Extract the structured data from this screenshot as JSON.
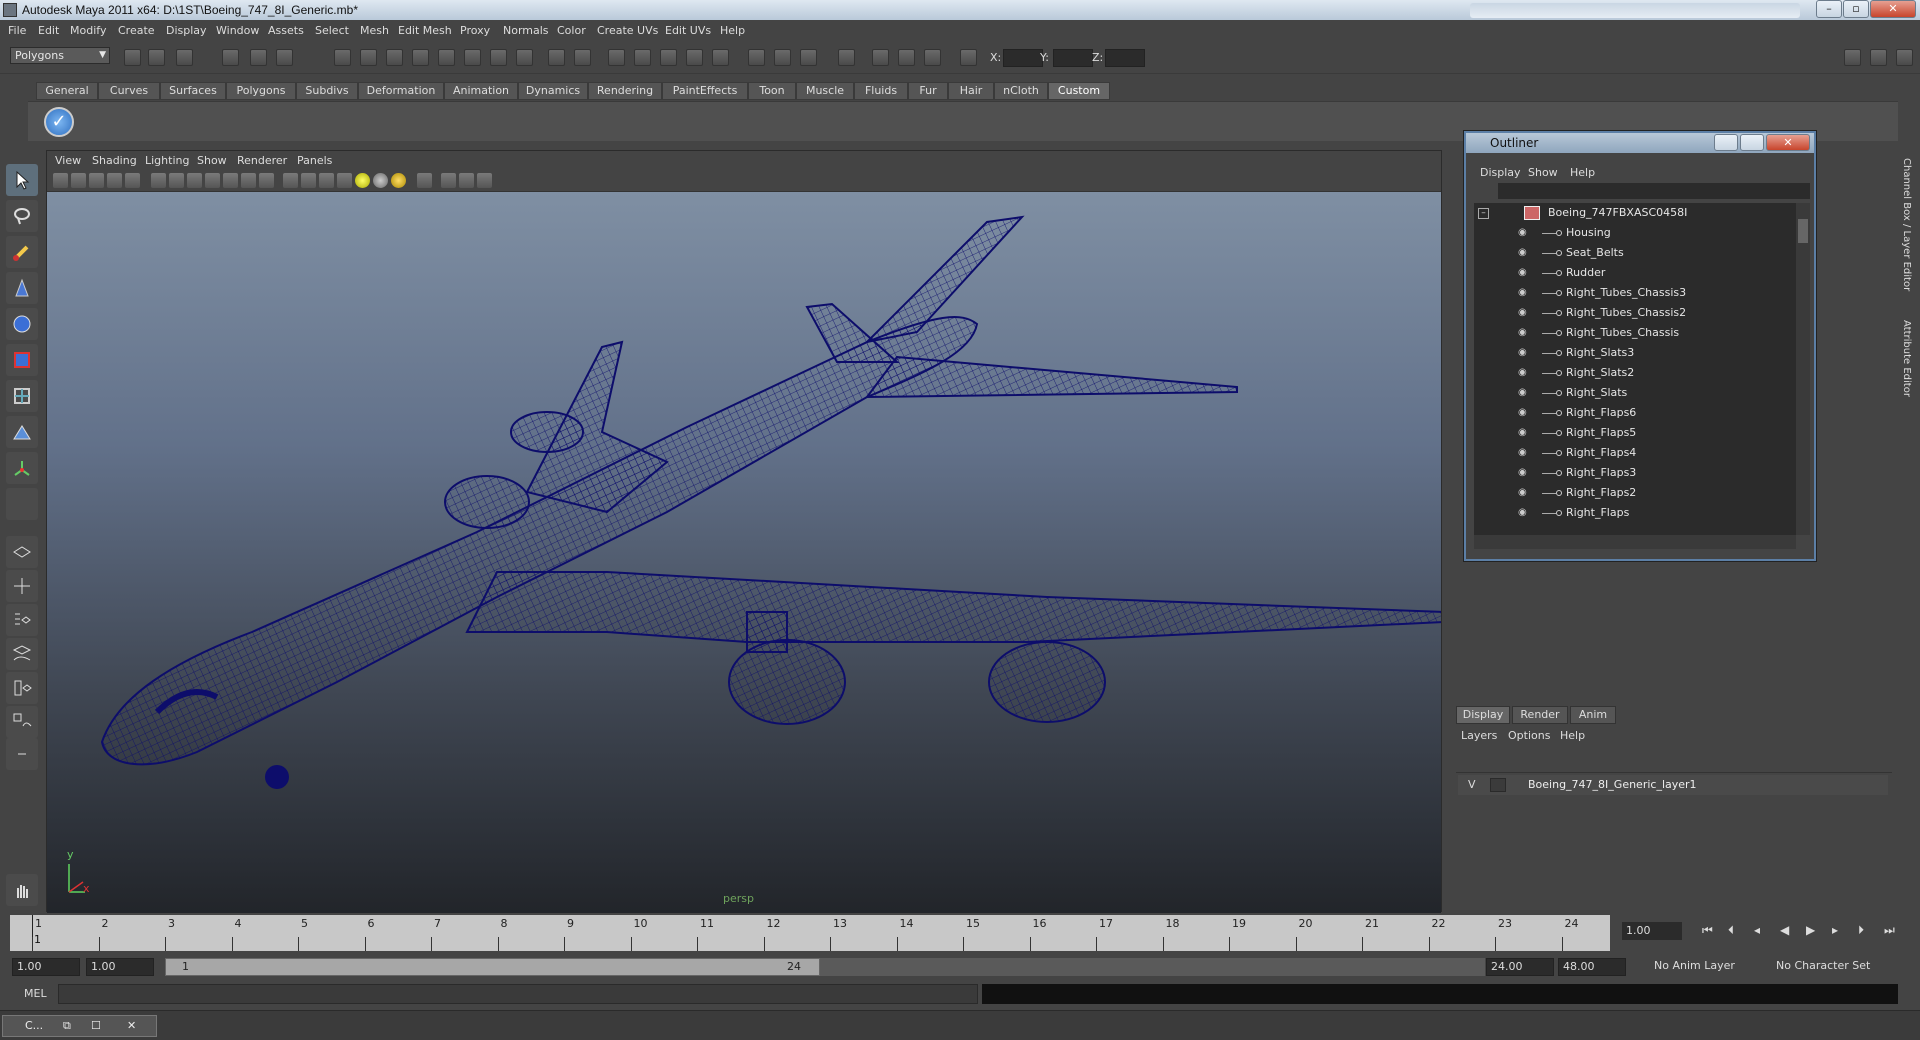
{
  "window": {
    "title": "Autodesk Maya 2011 x64: D:\\1ST\\Boeing_747_8I_Generic.mb*",
    "minimize": "–",
    "maximize": "▫",
    "close": "✕"
  },
  "menubar": [
    "File",
    "Edit",
    "Modify",
    "Create",
    "Display",
    "Window",
    "Assets",
    "Select",
    "Mesh",
    "Edit Mesh",
    "Proxy",
    "Normals",
    "Color",
    "Create UVs",
    "Edit UVs",
    "Help"
  ],
  "status": {
    "mode": "Polygons",
    "x_label": "X:",
    "y_label": "Y:",
    "z_label": "Z:"
  },
  "shelf_tabs": [
    "General",
    "Curves",
    "Surfaces",
    "Polygons",
    "Subdivs",
    "Deformation",
    "Animation",
    "Dynamics",
    "Rendering",
    "PaintEffects",
    "Toon",
    "Muscle",
    "Fluids",
    "Fur",
    "Hair",
    "nCloth",
    "Custom"
  ],
  "shelf_active": "Custom",
  "viewport": {
    "menu": [
      "View",
      "Shading",
      "Lighting",
      "Show",
      "Renderer",
      "Panels"
    ],
    "camera": "persp",
    "axis_y": "y",
    "axis_x": "x",
    "wire_color": "#0d0d6b"
  },
  "outliner": {
    "title": "Outliner",
    "menu": [
      "Display",
      "Show",
      "Help"
    ],
    "root": "Boeing_747FBXASC0458I",
    "items": [
      "Housing",
      "Seat_Belts",
      "Rudder",
      "Right_Tubes_Chassis3",
      "Right_Tubes_Chassis2",
      "Right_Tubes_Chassis",
      "Right_Slats3",
      "Right_Slats2",
      "Right_Slats",
      "Right_Flaps6",
      "Right_Flaps5",
      "Right_Flaps4",
      "Right_Flaps3",
      "Right_Flaps2",
      "Right_Flaps"
    ]
  },
  "side_tabs": [
    "Channel Box / Layer Editor",
    "Attribute Editor"
  ],
  "layers": {
    "tabs": [
      "Display",
      "Render",
      "Anim"
    ],
    "active_tab": "Display",
    "menu": [
      "Layers",
      "Options",
      "Help"
    ],
    "rows": [
      {
        "visible": "V",
        "name": "Boeing_747_8I_Generic_layer1"
      }
    ]
  },
  "timeline": {
    "ticks": [
      "1",
      "2",
      "3",
      "4",
      "5",
      "6",
      "7",
      "8",
      "9",
      "10",
      "11",
      "12",
      "13",
      "14",
      "15",
      "16",
      "17",
      "18",
      "19",
      "20",
      "21",
      "22",
      "23",
      "24"
    ],
    "current_frame": "1",
    "current_time": "1.00"
  },
  "range": {
    "start_time": "1.00",
    "start_range": "1.00",
    "handle_start": "1",
    "handle_end": "24",
    "end_range": "24.00",
    "end_time": "48.00",
    "anim_layer": "No Anim Layer",
    "char_set": "No Character Set"
  },
  "cmdline": {
    "label": "MEL"
  },
  "taskbar": {
    "item": "C..."
  }
}
